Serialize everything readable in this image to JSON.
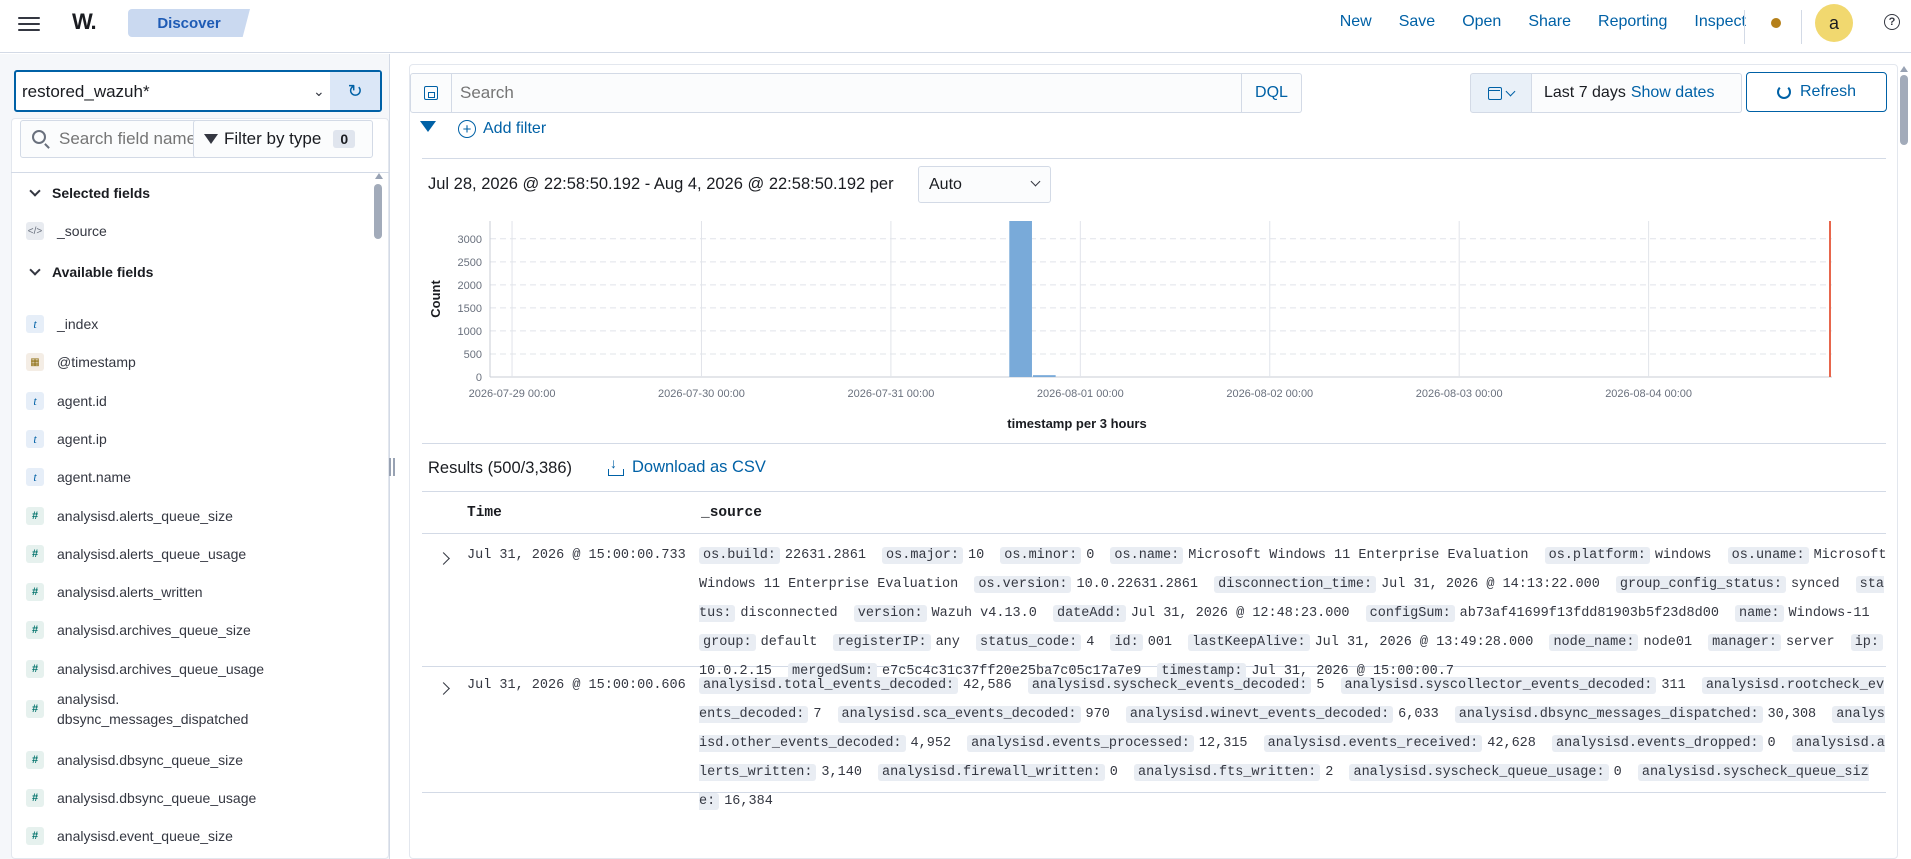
{
  "header": {
    "logo": "W.",
    "breadcrumb": "Discover",
    "nav": [
      "New",
      "Save",
      "Open",
      "Share",
      "Reporting",
      "Inspect"
    ],
    "avatar": "a",
    "help": "?"
  },
  "sidebar": {
    "index_pattern": "restored_wazuh*",
    "search_placeholder": "Search field names",
    "filter_by_type": "Filter by type",
    "filter_count": "0",
    "selected_title": "Selected fields",
    "selected_fields": [
      {
        "type": "source",
        "name": "_source"
      }
    ],
    "available_title": "Available fields",
    "available_fields": [
      {
        "type": "t",
        "name": "_index"
      },
      {
        "type": "date",
        "name": "@timestamp"
      },
      {
        "type": "t",
        "name": "agent.id"
      },
      {
        "type": "t",
        "name": "agent.ip"
      },
      {
        "type": "t",
        "name": "agent.name"
      },
      {
        "type": "#",
        "name": "analysisd.alerts_queue_size"
      },
      {
        "type": "#",
        "name": "analysisd.alerts_queue_usage"
      },
      {
        "type": "#",
        "name": "analysisd.alerts_written"
      },
      {
        "type": "#",
        "name": "analysisd.archives_queue_size"
      },
      {
        "type": "#",
        "name": "analysisd.archives_queue_usage"
      },
      {
        "type": "#",
        "name": "analysisd. dbsync_messages_dispatched"
      },
      {
        "type": "#",
        "name": "analysisd.dbsync_queue_size"
      },
      {
        "type": "#",
        "name": "analysisd.dbsync_queue_usage"
      },
      {
        "type": "#",
        "name": "analysisd.event_queue_size"
      }
    ]
  },
  "query": {
    "search_placeholder": "Search",
    "language": "DQL",
    "time_label": "Last 7 days",
    "show_dates": "Show dates",
    "refresh": "Refresh",
    "add_filter": "Add filter"
  },
  "histogram": {
    "range_text": "Jul 28, 2026 @ 22:58:50.192 - Aug 4, 2026 @ 22:58:50.192 per",
    "interval": "Auto"
  },
  "chart_data": {
    "type": "bar",
    "xlabel": "timestamp per 3 hours",
    "ylabel": "Count",
    "ylim": [
      0,
      3386
    ],
    "yticks": [
      0,
      500,
      1000,
      1500,
      2000,
      2500,
      3000
    ],
    "x_tick_labels": [
      "2026-07-29 00:00",
      "2026-07-30 00:00",
      "2026-07-31 00:00",
      "2026-08-01 00:00",
      "2026-08-02 00:00",
      "2026-08-03 00:00",
      "2026-08-04 00:00"
    ],
    "bars": [
      {
        "x": "2026-07-31 15:00",
        "value": 3386
      },
      {
        "x": "2026-07-31 18:00",
        "value": 40
      }
    ],
    "now_marker": "2026-08-04 22:58:50.192"
  },
  "results": {
    "title": "Results (500/3,386)",
    "download": "Download as CSV",
    "col_time": "Time",
    "col_source": "_source",
    "rows": [
      {
        "time": "Jul 31, 2026 @ 15:00:00.733",
        "fields": [
          [
            "os.build:",
            "22631.2861"
          ],
          [
            "os.major:",
            "10"
          ],
          [
            "os.minor:",
            "0"
          ],
          [
            "os.name:",
            "Microsoft Windows 11 Enterprise Evaluation"
          ],
          [
            "os.platform:",
            "windows"
          ],
          [
            "os.uname:",
            "Microsoft Windows 11 Enterprise Evaluation"
          ],
          [
            "os.version:",
            "10.0.22631.2861"
          ],
          [
            "disconnection_time:",
            "Jul 31, 2026 @ 14:13:22.000"
          ],
          [
            "group_config_status:",
            "synced"
          ],
          [
            "status:",
            "disconnected"
          ],
          [
            "version:",
            "Wazuh v4.13.0"
          ],
          [
            "dateAdd:",
            "Jul 31, 2026 @ 12:48:23.000"
          ],
          [
            "configSum:",
            "ab73af41699f13fdd81903b5f23d8d00"
          ],
          [
            "name:",
            "Windows-11"
          ],
          [
            "group:",
            "default"
          ],
          [
            "registerIP:",
            "any"
          ],
          [
            "status_code:",
            "4"
          ],
          [
            "id:",
            "001"
          ],
          [
            "lastKeepAlive:",
            "Jul 31, 2026 @ 13:49:28.000"
          ],
          [
            "node_name:",
            "node01"
          ],
          [
            "manager:",
            "server"
          ],
          [
            "ip:",
            "10.0.2.15"
          ],
          [
            "mergedSum:",
            "e7c5c4c31c37ff20e25ba7c05c17a7e9"
          ],
          [
            "timestamp:",
            "Jul 31, 2026 @ 15:00:00.7"
          ]
        ]
      },
      {
        "time": "Jul 31, 2026 @ 15:00:00.606",
        "fields": [
          [
            "analysisd.total_events_decoded:",
            "42,586"
          ],
          [
            "analysisd.syscheck_events_decoded:",
            "5"
          ],
          [
            "analysisd.syscollector_events_decoded:",
            "311"
          ],
          [
            "analysisd.rootcheck_events_decoded:",
            "7"
          ],
          [
            "analysisd.sca_events_decoded:",
            "970"
          ],
          [
            "analysisd.winevt_events_decoded:",
            "6,033"
          ],
          [
            "analysisd.dbsync_messages_dispatched:",
            "30,308"
          ],
          [
            "analysisd.other_events_decoded:",
            "4,952"
          ],
          [
            "analysisd.events_processed:",
            "12,315"
          ],
          [
            "analysisd.events_received:",
            "42,628"
          ],
          [
            "analysisd.events_dropped:",
            "0"
          ],
          [
            "analysisd.alerts_written:",
            "3,140"
          ],
          [
            "analysisd.firewall_written:",
            "0"
          ],
          [
            "analysisd.fts_written:",
            "2"
          ],
          [
            "analysisd.syscheck_queue_usage:",
            "0"
          ],
          [
            "analysisd.syscheck_queue_size:",
            "16,384"
          ]
        ]
      }
    ]
  }
}
